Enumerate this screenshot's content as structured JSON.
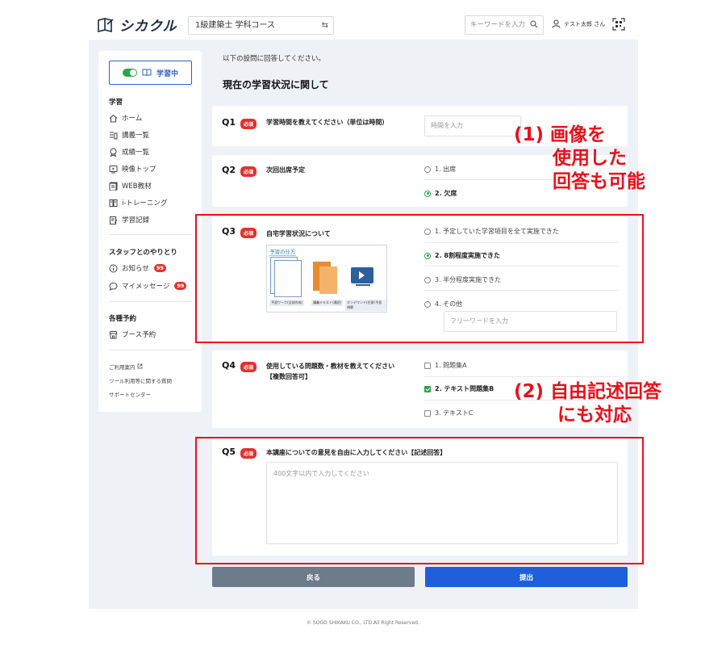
{
  "header": {
    "logo_text": "シカクル",
    "course": "1級建築士 学科コース",
    "search_placeholder": "キーワードを入力",
    "user_name": "テスト太郎 さん"
  },
  "sidebar": {
    "study_status": "学習中",
    "section_study": "学習",
    "study_items": [
      "ホーム",
      "講義一覧",
      "成績一覧",
      "映像トップ",
      "WEB教材",
      "i-トレーニング",
      "学習記録"
    ],
    "section_staff": "スタッフとのやりとり",
    "notice_label": "お知らせ",
    "notice_badge": "99",
    "message_label": "マイメッセージ",
    "message_badge": "99",
    "section_reserve": "各種予約",
    "booth_label": "ブース予約",
    "links": [
      "ご利用案内",
      "ツール利用等に関する質問",
      "サポートセンター"
    ]
  },
  "main": {
    "intro": "以下の設問に回答してください。",
    "title": "現在の学習状況に関して",
    "required": "必須",
    "q1": {
      "num": "Q1",
      "text": "学習時間を教えてください（単位は時間）",
      "placeholder": "時間を入力"
    },
    "q2": {
      "num": "Q2",
      "text": "次回出席予定",
      "options": [
        "1. 出席",
        "2. 欠席"
      ],
      "selected": 1
    },
    "q3": {
      "num": "Q3",
      "text": "自宅学習状況について",
      "image_title": "予習の仕方",
      "image_captions": [
        "予習ワーク(全部作成)",
        "講義テキスト(通読)",
        "オンデマンド(任意)予習視聴"
      ],
      "options": [
        "1. 予定していた学習項目を全て実施できた",
        "2. 8割程度実施できた",
        "3. 半分程度実施できた",
        "4. その他"
      ],
      "selected": 1,
      "free_placeholder": "フリーワードを入力"
    },
    "q4": {
      "num": "Q4",
      "text_line1": "使用している問題数・教材を教えてください",
      "text_line2": "【複数回答可】",
      "options": [
        "1. 問題集A",
        "2. テキスト問題集B",
        "3. テキストC"
      ],
      "checked": [
        false,
        true,
        false
      ]
    },
    "q5": {
      "num": "Q5",
      "text": "本講座についての意見を自由に入力してください【記述回答】",
      "placeholder": "400文字以内で入力してください"
    },
    "back_label": "戻る",
    "submit_label": "提出"
  },
  "annotations": {
    "anno1": [
      "(1) 画像を",
      "使用した",
      "回答も可能"
    ],
    "anno2": [
      "(2) 自由記述回答",
      "にも対応"
    ],
    "color": "#e8101b"
  },
  "footer": "© SOGO SHIKAKU CO., LTD.All Right Reserved."
}
